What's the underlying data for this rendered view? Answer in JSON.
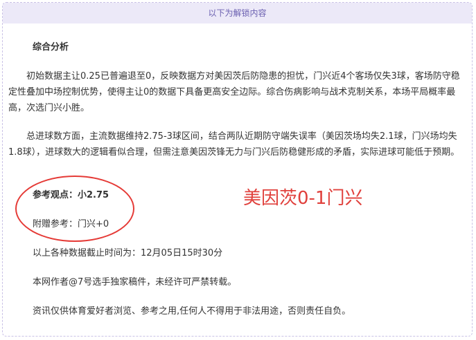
{
  "banner": {
    "text": "以下为解锁内容"
  },
  "article": {
    "section_title": "综合分析",
    "paragraph1": "初始数据主让0.25已普遍退至0，反映数据方对美因茨后防隐患的担忧，门兴近4个客场仅失3球，客场防守稳定性叠加中场控制优势，使得主让0的数据下具备更高安全边际。综合伤病影响与战术克制关系，本场平局概率最高，次选门兴小胜。",
    "paragraph2": "总进球数方面，主流数据维持2.75-3球区间，结合两队近期防守端失误率（美因茨场均失2.1球，门兴场均失1.8球），进球数大的逻辑看似合理，但需注意美因茨锋无力与门兴后防稳健形成的矛盾，实际进球可能低于预期。",
    "reference_view": "参考观点：小2.75",
    "handicap_reference": "附赠参考：门兴+0",
    "data_cutoff": "以上各种数据截止时间为：12月05日15时30分",
    "author_notice": "本网作者@7号选手独家稿件，未经许可严禁转载。",
    "disclaimer": "资讯仅供体育爱好者浏览、参考之用,任何人不得用于非法用途，否则责任自负。"
  },
  "annotation": {
    "handwritten_result": "美因茨0-1门兴",
    "color": "#e0403c"
  }
}
